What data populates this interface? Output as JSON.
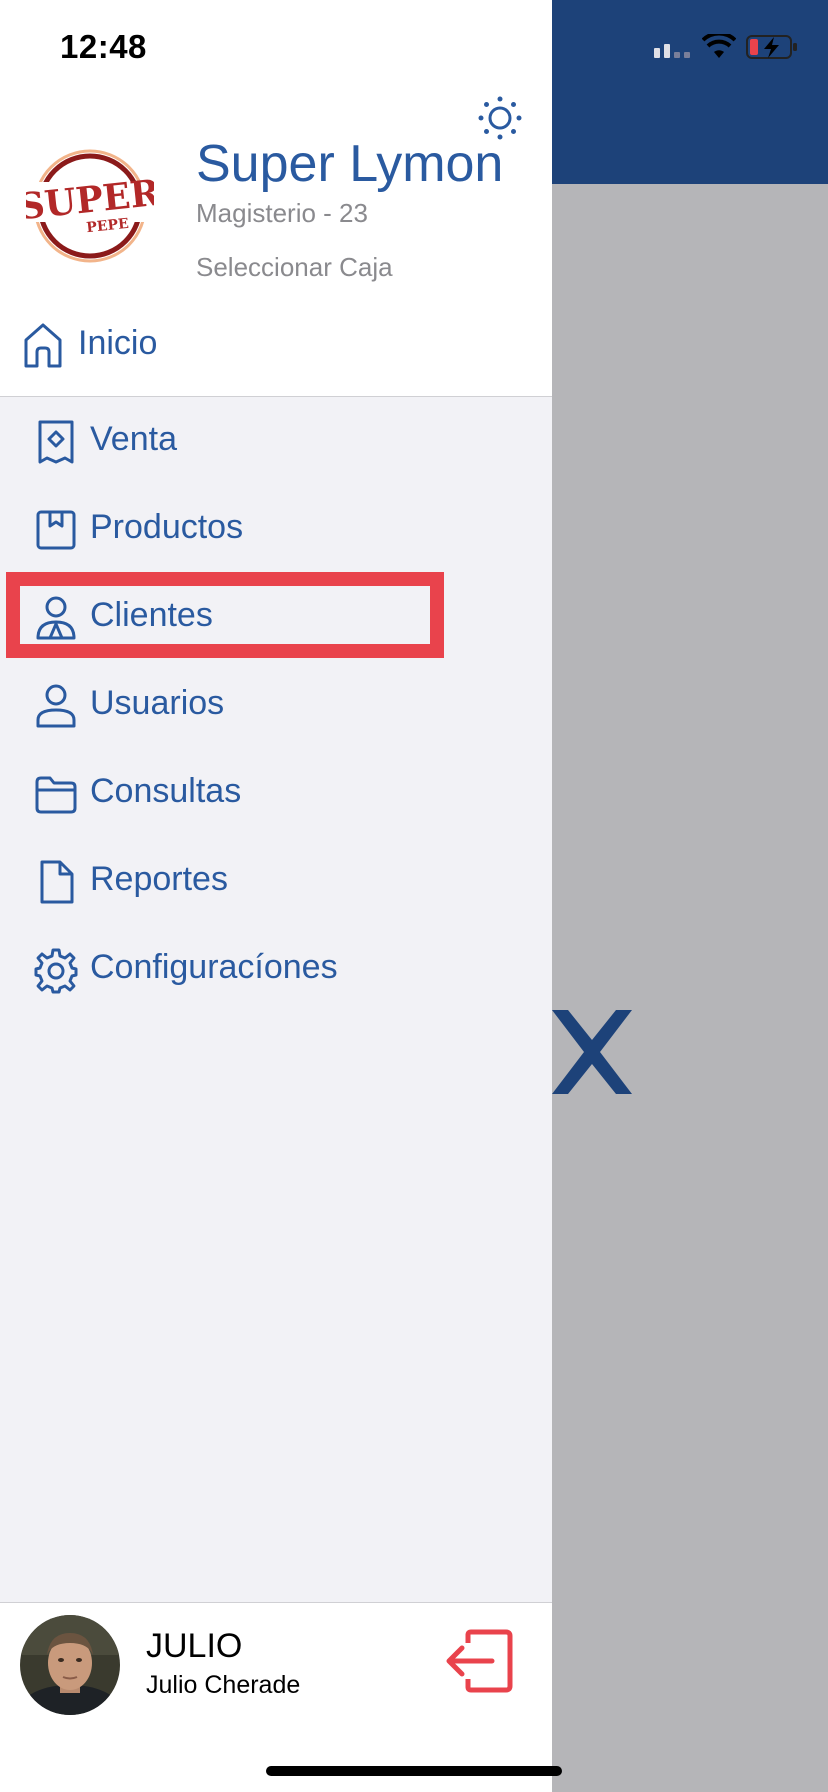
{
  "status_bar": {
    "time": "12:48"
  },
  "store": {
    "name": "Super Lymon",
    "subtitle": "Magisterio - 23",
    "select_box": "Seleccionar Caja",
    "logo_text_main": "SUPER",
    "logo_text_sub": "PEPE"
  },
  "nav": {
    "home": "Inicio",
    "items": [
      {
        "label": "Venta",
        "icon": "receipt-icon"
      },
      {
        "label": "Productos",
        "icon": "book-icon"
      },
      {
        "label": "Clientes",
        "icon": "clients-icon"
      },
      {
        "label": "Usuarios",
        "icon": "user-icon"
      },
      {
        "label": "Consultas",
        "icon": "folder-icon"
      },
      {
        "label": "Reportes",
        "icon": "document-icon"
      },
      {
        "label": "Configuracíones",
        "icon": "gear-icon"
      }
    ],
    "highlighted": "Clientes"
  },
  "user": {
    "short_name": "JULIO",
    "full_name": "Julio Cherade"
  },
  "colors": {
    "accent": "#2a5aa0",
    "header_bg": "#1d4279",
    "highlight": "#e9434c",
    "logout": "#e9434c"
  }
}
